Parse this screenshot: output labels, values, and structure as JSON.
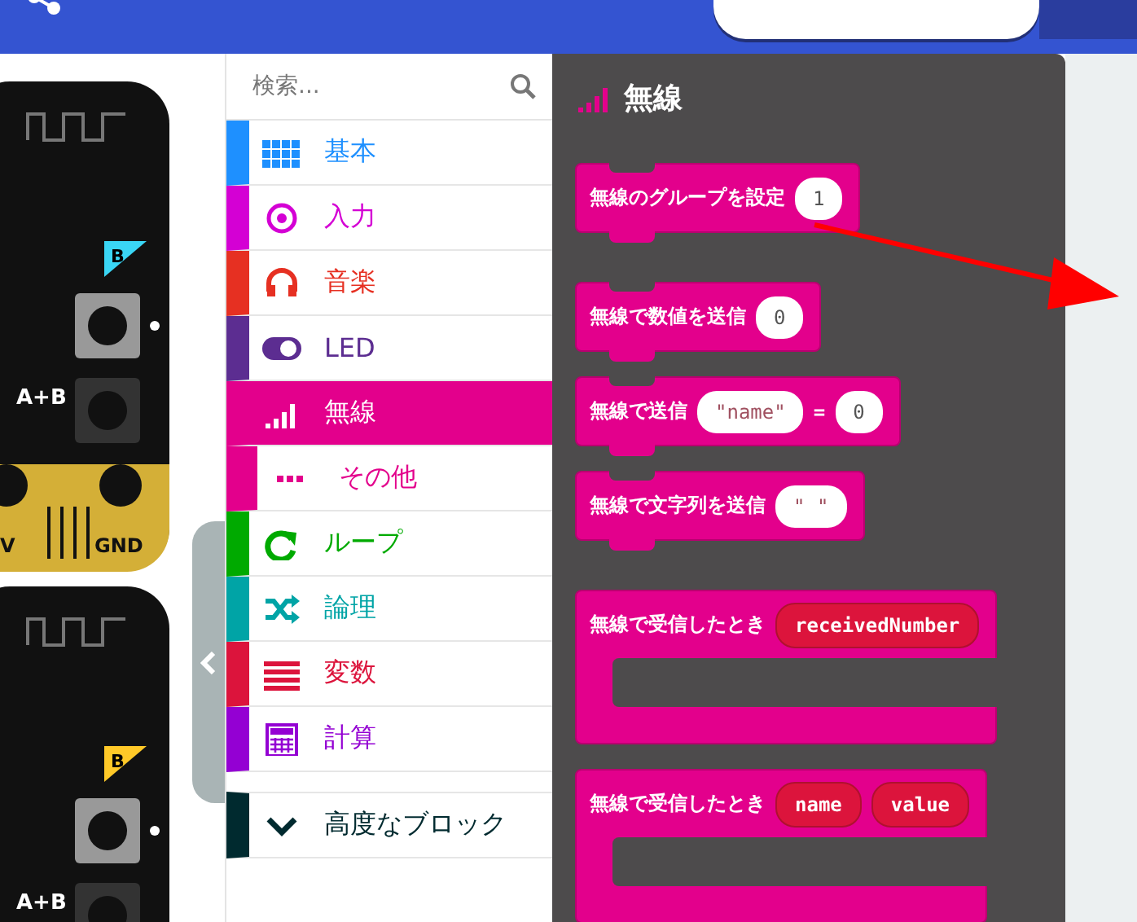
{
  "header": {
    "tabs": [
      {
        "selected": true
      },
      {
        "selected": false
      }
    ]
  },
  "simulator": {
    "labels": [
      "B",
      "A+B",
      "V",
      "GND",
      "B",
      "A+B"
    ]
  },
  "search": {
    "placeholder": "検索..."
  },
  "categories": [
    {
      "label": "基本",
      "color": "#1e90ff",
      "selected": false
    },
    {
      "label": "入力",
      "color": "#d400d4",
      "selected": false
    },
    {
      "label": "音楽",
      "color": "#e63022",
      "selected": false
    },
    {
      "label": "LED",
      "color": "#5c2d91",
      "selected": false
    },
    {
      "label": "無線",
      "color": "#e3008c",
      "selected": true,
      "children": [
        {
          "label": "その他",
          "color": "#e3008c",
          "selected": false
        }
      ]
    },
    {
      "label": "ループ",
      "color": "#00aa00",
      "selected": false
    },
    {
      "label": "論理",
      "color": "#00a4a6",
      "selected": false
    },
    {
      "label": "変数",
      "color": "#dc143c",
      "selected": false
    },
    {
      "label": "計算",
      "color": "#9400d3",
      "selected": false
    },
    {
      "label": "高度なブロック",
      "color": "#002a2f",
      "selected": false,
      "kind": "advanced"
    }
  ],
  "flyout": {
    "title": "無線",
    "blocks": [
      {
        "kind": "statement",
        "text": "無線のグループを設定",
        "inputs": [
          {
            "kind": "number",
            "text": "1"
          }
        ]
      },
      {
        "kind": "statement",
        "text": "無線で数値を送信",
        "inputs": [
          {
            "kind": "number",
            "text": "0"
          }
        ]
      },
      {
        "kind": "statement",
        "text": "無線で送信",
        "inputs": [
          {
            "kind": "string",
            "text": "\"name\""
          },
          {
            "kind": "label",
            "text": "="
          },
          {
            "kind": "number",
            "text": "0"
          }
        ]
      },
      {
        "kind": "statement",
        "text": "無線で文字列を送信",
        "inputs": [
          {
            "kind": "string",
            "text": "\" \""
          }
        ]
      },
      {
        "kind": "event",
        "text": "無線で受信したとき",
        "inputs": [
          {
            "kind": "variable",
            "text": "receivedNumber"
          }
        ]
      },
      {
        "kind": "event",
        "text": "無線で受信したとき",
        "inputs": [
          {
            "kind": "variable",
            "text": "name"
          },
          {
            "kind": "variable",
            "text": "value"
          }
        ]
      }
    ]
  }
}
